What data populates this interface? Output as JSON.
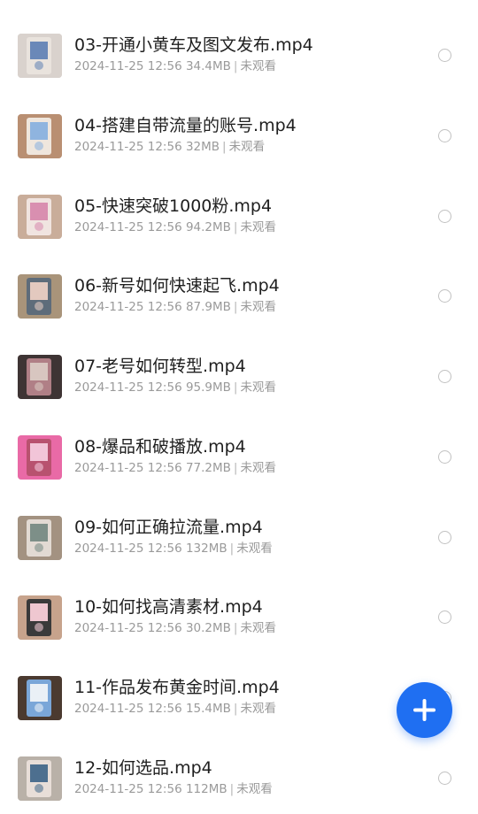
{
  "files": [
    {
      "name": "03-开通小黄车及图文发布.mp4",
      "date": "2024-11-25 12:56",
      "size": "34.4MB",
      "status": "未观看",
      "thumb_colors": [
        "#d9d2cd",
        "#6a88b8",
        "#e9e3dd"
      ]
    },
    {
      "name": "04-搭建自带流量的账号.mp4",
      "date": "2024-11-25 12:56",
      "size": "32MB",
      "status": "未观看",
      "thumb_colors": [
        "#b98f72",
        "#8fb4df",
        "#efe6dd"
      ]
    },
    {
      "name": "05-快速突破1000粉.mp4",
      "date": "2024-11-25 12:56",
      "size": "94.2MB",
      "status": "未观看",
      "thumb_colors": [
        "#c9ad9a",
        "#d98fb0",
        "#f0e4e0"
      ]
    },
    {
      "name": "06-新号如何快速起飞.mp4",
      "date": "2024-11-25 12:56",
      "size": "87.9MB",
      "status": "未观看",
      "thumb_colors": [
        "#a9947a",
        "#e3c9bf",
        "#5e6c7a"
      ]
    },
    {
      "name": "07-老号如何转型.mp4",
      "date": "2024-11-25 12:56",
      "size": "95.9MB",
      "status": "未观看",
      "thumb_colors": [
        "#3e3434",
        "#d8c6c0",
        "#b07f86"
      ]
    },
    {
      "name": "08-爆品和破播放.mp4",
      "date": "2024-11-25 12:56",
      "size": "77.2MB",
      "status": "未观看",
      "thumb_colors": [
        "#e96aa6",
        "#f2c5d8",
        "#b8526f"
      ]
    },
    {
      "name": "09-如何正确拉流量.mp4",
      "date": "2024-11-25 12:56",
      "size": "132MB",
      "status": "未观看",
      "thumb_colors": [
        "#a39281",
        "#7d8f88",
        "#e2dad3"
      ]
    },
    {
      "name": "10-如何找高清素材.mp4",
      "date": "2024-11-25 12:56",
      "size": "30.2MB",
      "status": "未观看",
      "thumb_colors": [
        "#c7a38c",
        "#efc7d0",
        "#3a3a3a"
      ]
    },
    {
      "name": "11-作品发布黄金时间.mp4",
      "date": "2024-11-25 12:56",
      "size": "15.4MB",
      "status": "未观看",
      "thumb_colors": [
        "#4b3a30",
        "#eaf0f6",
        "#7aa6d8"
      ]
    },
    {
      "name": "12-如何选品.mp4",
      "date": "2024-11-25 12:56",
      "size": "112MB",
      "status": "未观看",
      "thumb_colors": [
        "#b9b1a8",
        "#4d6f8f",
        "#e8ded8"
      ]
    }
  ],
  "fab": {
    "icon": "plus-icon",
    "color": "#1f6ff2"
  },
  "colors": {
    "title": "#1f1f1f",
    "meta": "#9a9a9a",
    "radio_border": "#c2c2c2"
  }
}
